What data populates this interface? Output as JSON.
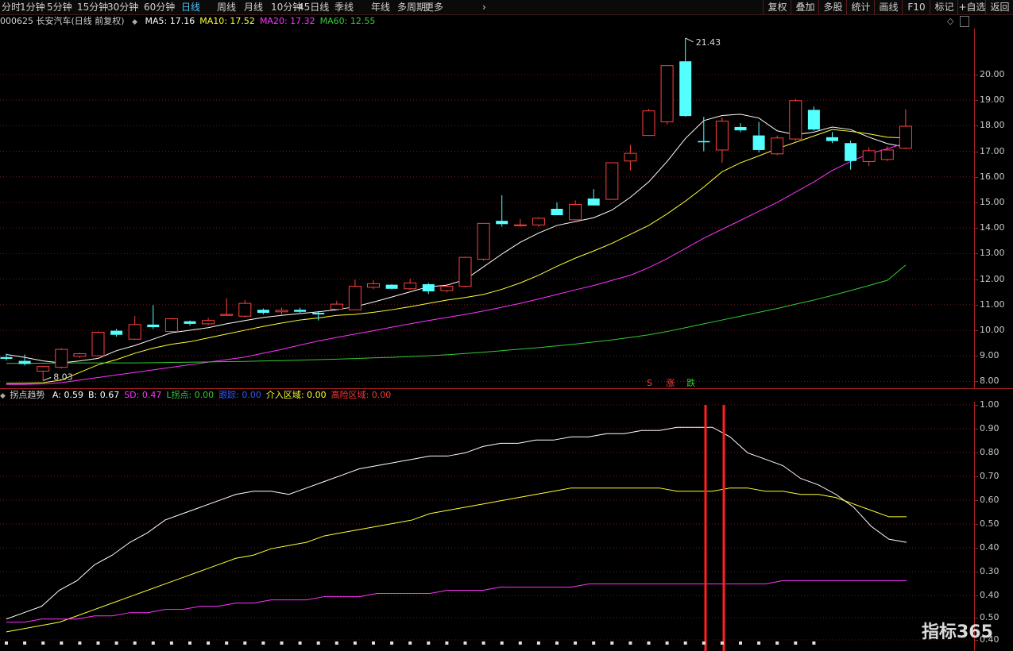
{
  "toolbar": {
    "periods": [
      "分时",
      "1分钟",
      "5分钟",
      "15分钟",
      "30分钟",
      "60分钟",
      "日线",
      "周线",
      "月线",
      "10分钟",
      "45日线",
      "季线",
      "年线",
      "多周期",
      "更多"
    ],
    "active_period": "日线",
    "more_chevron": "›",
    "right_buttons": [
      "复权",
      "叠加",
      "多股",
      "统计",
      "画线",
      "F10",
      "标记",
      "+自选",
      "返回"
    ]
  },
  "main_header": {
    "title": "000625 长安汽车(日线 前复权)",
    "ma": [
      {
        "label": "MA5: 17.16",
        "color": "#ffffff"
      },
      {
        "label": "MA10: 17.52",
        "color": "#ffff33"
      },
      {
        "label": "MA20: 17.32",
        "color": "#ff33ff"
      },
      {
        "label": "MA60: 12.55",
        "color": "#33cc33"
      }
    ]
  },
  "main_axis": {
    "ticks": [
      "20.00",
      "19.00",
      "18.00",
      "17.00",
      "16.00",
      "15.00",
      "14.00",
      "13.00",
      "12.00",
      "11.00",
      "10.00",
      "9.00",
      "8.00"
    ]
  },
  "annotations": {
    "high": "21.43",
    "low": "8.03",
    "sig_s": "S",
    "sig_up": "涨",
    "sig_down": "跌"
  },
  "indicator_header": {
    "name": "拐点趋势",
    "items": [
      {
        "label": "A: 0.59",
        "color": "#ffffff"
      },
      {
        "label": "B: 0.67",
        "color": "#ffffff"
      },
      {
        "label": "SD: 0.47",
        "color": "#ff33ff"
      },
      {
        "label": "L拐点: 0.00",
        "color": "#33cc33"
      },
      {
        "label": "跟踪: 0.00",
        "color": "#3355ff"
      },
      {
        "label": "介入区域: 0.00",
        "color": "#ffff33"
      },
      {
        "label": "高险区域: 0.00",
        "color": "#ff3333"
      }
    ]
  },
  "indicator_axis": {
    "ticks": [
      "1.00",
      "0.90",
      "0.80",
      "0.70",
      "0.60",
      "0.50",
      "0.40",
      "0.30",
      "0.40",
      "0.50",
      "0.40"
    ]
  },
  "watermark": "指标365",
  "colors": {
    "up": "#ff4040",
    "down": "#54ffff",
    "ma5": "#ffffff",
    "ma10": "#ffff33",
    "ma20": "#ff33ff",
    "ma60": "#33cc33",
    "grid": "#7a1515"
  },
  "chart_data": [
    {
      "type": "candlestick",
      "title": "000625 长安汽车(日线 前复权)",
      "ylim": [
        7.7,
        21.8
      ],
      "ohlc": [
        [
          8.95,
          9.08,
          8.82,
          8.88
        ],
        [
          8.8,
          9.05,
          8.62,
          8.68
        ],
        [
          8.4,
          8.6,
          8.03,
          8.58
        ],
        [
          8.55,
          9.3,
          8.5,
          9.25
        ],
        [
          8.98,
          9.12,
          8.92,
          9.08
        ],
        [
          9.0,
          9.95,
          8.98,
          9.92
        ],
        [
          9.98,
          10.05,
          9.75,
          9.82
        ],
        [
          9.65,
          10.55,
          9.62,
          10.22
        ],
        [
          10.22,
          10.98,
          10.05,
          10.12
        ],
        [
          9.95,
          10.48,
          9.9,
          10.45
        ],
        [
          10.35,
          10.38,
          10.18,
          10.25
        ],
        [
          10.25,
          10.48,
          10.2,
          10.38
        ],
        [
          10.58,
          11.25,
          10.58,
          10.62
        ],
        [
          10.55,
          11.18,
          10.5,
          11.05
        ],
        [
          10.8,
          10.85,
          10.62,
          10.68
        ],
        [
          10.72,
          10.88,
          10.58,
          10.78
        ],
        [
          10.8,
          10.88,
          10.68,
          10.72
        ],
        [
          10.68,
          10.75,
          10.38,
          10.62
        ],
        [
          10.82,
          11.15,
          10.78,
          11.02
        ],
        [
          10.8,
          11.98,
          10.78,
          11.72
        ],
        [
          11.68,
          11.95,
          11.6,
          11.82
        ],
        [
          11.78,
          11.8,
          11.6,
          11.62
        ],
        [
          11.62,
          12.02,
          11.58,
          11.85
        ],
        [
          11.8,
          11.85,
          11.42,
          11.52
        ],
        [
          11.55,
          11.82,
          11.48,
          11.72
        ],
        [
          11.72,
          12.88,
          11.68,
          12.85
        ],
        [
          12.78,
          14.18,
          12.72,
          14.18
        ],
        [
          14.28,
          15.28,
          14.05,
          14.15
        ],
        [
          14.12,
          14.35,
          14.05,
          14.12
        ],
        [
          14.12,
          14.42,
          14.05,
          14.38
        ],
        [
          14.75,
          15.0,
          14.55,
          14.5
        ],
        [
          14.32,
          15.08,
          14.3,
          14.92
        ],
        [
          15.15,
          15.52,
          14.88,
          14.88
        ],
        [
          15.12,
          16.55,
          15.1,
          16.55
        ],
        [
          16.62,
          17.25,
          16.25,
          16.92
        ],
        [
          17.62,
          18.65,
          17.6,
          18.58
        ],
        [
          18.15,
          20.35,
          18.05,
          20.35
        ],
        [
          20.52,
          21.43,
          18.35,
          18.38
        ],
        [
          17.4,
          18.35,
          17.0,
          17.35
        ],
        [
          17.05,
          18.32,
          16.55,
          18.18
        ],
        [
          17.95,
          18.1,
          17.75,
          17.82
        ],
        [
          17.62,
          18.15,
          16.95,
          17.05
        ],
        [
          16.9,
          17.62,
          16.85,
          17.52
        ],
        [
          17.48,
          19.05,
          17.42,
          18.98
        ],
        [
          18.62,
          18.75,
          17.8,
          17.85
        ],
        [
          17.55,
          17.75,
          17.32,
          17.4
        ],
        [
          17.32,
          17.42,
          16.28,
          16.62
        ],
        [
          16.6,
          17.15,
          16.42,
          17.02
        ],
        [
          16.68,
          17.2,
          16.62,
          17.05
        ],
        [
          17.12,
          18.65,
          17.08,
          17.98
        ]
      ],
      "series": [
        {
          "name": "MA5",
          "values": [
            9.05,
            8.94,
            8.8,
            8.72,
            8.8,
            8.9,
            9.2,
            9.4,
            9.65,
            9.9,
            10.0,
            10.1,
            10.25,
            10.38,
            10.5,
            10.58,
            10.65,
            10.72,
            10.8,
            10.92,
            11.1,
            11.3,
            11.5,
            11.7,
            11.76,
            11.98,
            12.48,
            12.98,
            13.44,
            13.8,
            14.1,
            14.25,
            14.4,
            14.7,
            15.2,
            15.8,
            16.6,
            17.5,
            18.2,
            18.4,
            18.45,
            18.3,
            17.8,
            17.65,
            17.75,
            17.95,
            17.85,
            17.55,
            17.3,
            17.16
          ]
        },
        {
          "name": "MA10",
          "values": [
            7.92,
            7.93,
            7.95,
            8.05,
            8.35,
            8.65,
            8.85,
            9.1,
            9.3,
            9.45,
            9.55,
            9.7,
            9.85,
            10.0,
            10.15,
            10.28,
            10.4,
            10.48,
            10.58,
            10.62,
            10.7,
            10.8,
            10.92,
            11.05,
            11.18,
            11.28,
            11.4,
            11.6,
            11.85,
            12.15,
            12.5,
            12.82,
            13.1,
            13.4,
            13.75,
            14.1,
            14.55,
            15.05,
            15.6,
            16.2,
            16.55,
            16.82,
            17.1,
            17.35,
            17.6,
            17.85,
            17.78,
            17.68,
            17.55,
            17.52
          ]
        },
        {
          "name": "MA20",
          "values": [
            7.88,
            7.88,
            7.9,
            7.95,
            8.05,
            8.15,
            8.25,
            8.35,
            8.45,
            8.55,
            8.65,
            8.75,
            8.85,
            8.95,
            9.1,
            9.25,
            9.42,
            9.58,
            9.72,
            9.85,
            9.98,
            10.12,
            10.25,
            10.38,
            10.5,
            10.62,
            10.75,
            10.9,
            11.05,
            11.22,
            11.4,
            11.58,
            11.75,
            11.95,
            12.15,
            12.45,
            12.8,
            13.2,
            13.6,
            13.95,
            14.3,
            14.65,
            15.0,
            15.4,
            15.8,
            16.25,
            16.6,
            16.9,
            17.1,
            17.32
          ]
        },
        {
          "name": "MA60",
          "values": [
            8.7,
            8.71,
            8.71,
            8.72,
            8.72,
            8.72,
            8.72,
            8.72,
            8.73,
            8.74,
            8.75,
            8.76,
            8.77,
            8.78,
            8.8,
            8.81,
            8.83,
            8.85,
            8.87,
            8.89,
            8.92,
            8.94,
            8.97,
            9.0,
            9.04,
            9.09,
            9.14,
            9.2,
            9.26,
            9.32,
            9.39,
            9.46,
            9.54,
            9.62,
            9.72,
            9.82,
            9.95,
            10.1,
            10.25,
            10.4,
            10.55,
            10.7,
            10.85,
            11.02,
            11.18,
            11.36,
            11.55,
            11.75,
            11.95,
            12.55
          ]
        }
      ]
    },
    {
      "type": "line",
      "title": "拐点趋势",
      "ylim": [
        0.25,
        1.03
      ],
      "series": [
        {
          "name": "A",
          "values": [
            0.35,
            0.37,
            0.39,
            0.44,
            0.47,
            0.52,
            0.55,
            0.59,
            0.62,
            0.66,
            0.68,
            0.7,
            0.72,
            0.74,
            0.75,
            0.75,
            0.74,
            0.76,
            0.78,
            0.8,
            0.82,
            0.83,
            0.84,
            0.85,
            0.86,
            0.86,
            0.87,
            0.89,
            0.9,
            0.9,
            0.91,
            0.91,
            0.92,
            0.92,
            0.93,
            0.93,
            0.94,
            0.94,
            0.95,
            0.95,
            0.95,
            0.92,
            0.87,
            0.85,
            0.83,
            0.79,
            0.77,
            0.74,
            0.7,
            0.64,
            0.6,
            0.59
          ]
        },
        {
          "name": "B",
          "values": [
            0.31,
            0.32,
            0.33,
            0.34,
            0.36,
            0.38,
            0.4,
            0.42,
            0.44,
            0.46,
            0.48,
            0.5,
            0.52,
            0.54,
            0.55,
            0.57,
            0.58,
            0.59,
            0.61,
            0.62,
            0.63,
            0.64,
            0.65,
            0.66,
            0.68,
            0.69,
            0.7,
            0.71,
            0.72,
            0.73,
            0.74,
            0.75,
            0.76,
            0.76,
            0.76,
            0.76,
            0.76,
            0.76,
            0.75,
            0.75,
            0.75,
            0.76,
            0.76,
            0.75,
            0.75,
            0.74,
            0.74,
            0.73,
            0.71,
            0.69,
            0.67,
            0.67
          ]
        },
        {
          "name": "SD",
          "values": [
            0.34,
            0.34,
            0.35,
            0.35,
            0.35,
            0.36,
            0.36,
            0.37,
            0.37,
            0.38,
            0.38,
            0.39,
            0.39,
            0.4,
            0.4,
            0.41,
            0.41,
            0.41,
            0.42,
            0.42,
            0.42,
            0.43,
            0.43,
            0.43,
            0.43,
            0.44,
            0.44,
            0.44,
            0.45,
            0.45,
            0.45,
            0.45,
            0.45,
            0.46,
            0.46,
            0.46,
            0.46,
            0.46,
            0.46,
            0.46,
            0.46,
            0.46,
            0.46,
            0.46,
            0.47,
            0.47,
            0.47,
            0.47,
            0.47,
            0.47,
            0.47,
            0.47
          ]
        }
      ],
      "signals": [
        38,
        39
      ]
    }
  ]
}
